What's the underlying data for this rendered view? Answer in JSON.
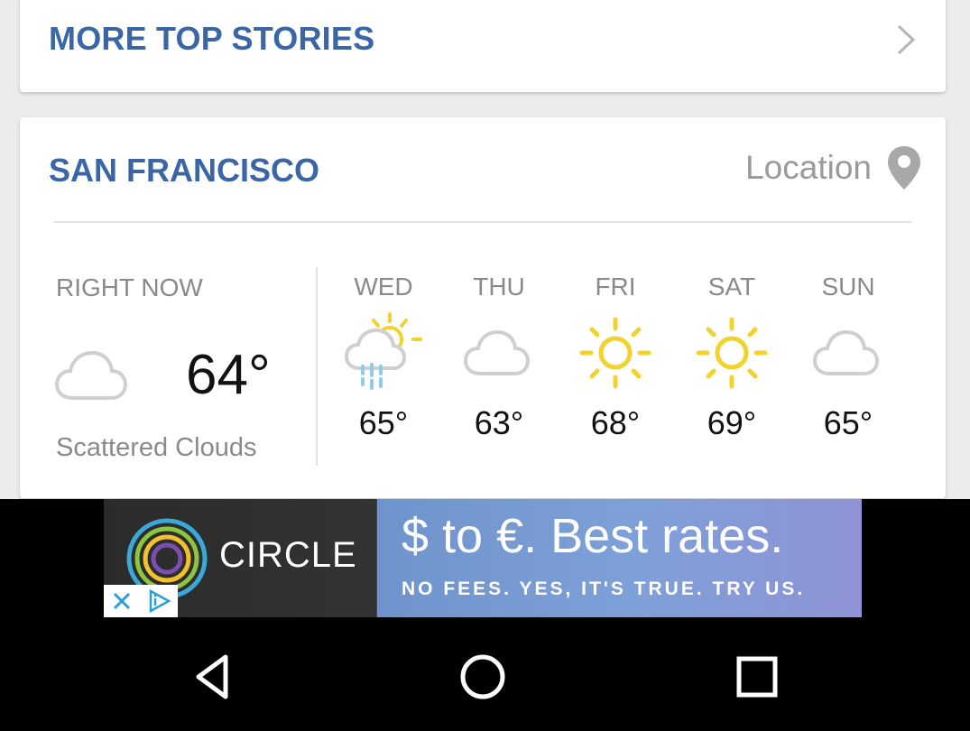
{
  "more_stories": {
    "label": "MORE TOP STORIES"
  },
  "weather": {
    "city": "SAN FRANCISCO",
    "location_label": "Location",
    "now": {
      "label": "RIGHT NOW",
      "temp": "64°",
      "condition": "Scattered Clouds",
      "icon": "cloud-icon"
    },
    "forecast": [
      {
        "day": "WED",
        "temp": "65°",
        "icon": "sun-rain-icon"
      },
      {
        "day": "THU",
        "temp": "63°",
        "icon": "cloud-icon"
      },
      {
        "day": "FRI",
        "temp": "68°",
        "icon": "sun-icon"
      },
      {
        "day": "SAT",
        "temp": "69°",
        "icon": "sun-icon"
      },
      {
        "day": "SUN",
        "temp": "65°",
        "icon": "cloud-icon"
      }
    ]
  },
  "ad": {
    "brand": "CIRCLE",
    "headline": "$ to €. Best rates.",
    "subline": "NO FEES. YES, IT'S TRUE. TRY US."
  },
  "nav": {
    "buttons": [
      "back-icon",
      "home-icon",
      "recents-icon"
    ]
  },
  "colors": {
    "accent": "#3b66a5",
    "sun": "#f2d22e",
    "rain": "#8ecbe6",
    "muted": "#8a8a8a"
  }
}
